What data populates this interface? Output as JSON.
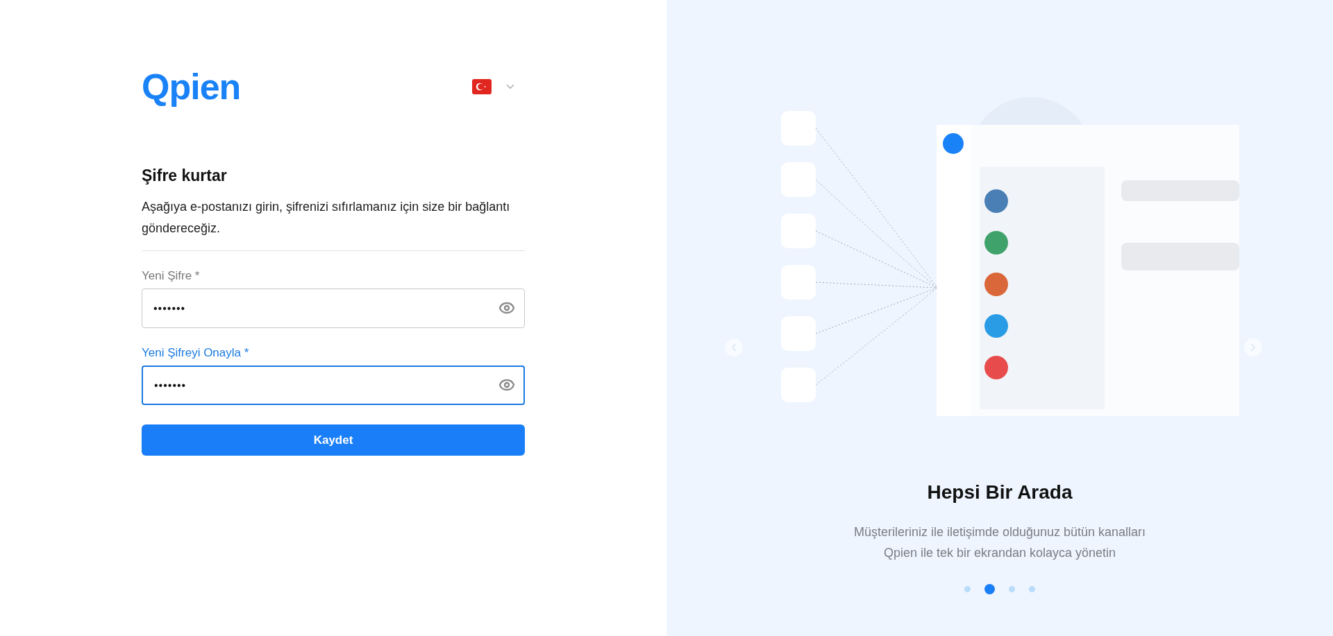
{
  "logo": {
    "text": "Qpien"
  },
  "form": {
    "title": "Şifre kurtar",
    "description": "Aşağıya e-postanızı girin, şifrenizi sıfırlamanız için size bir bağlantı göndereceğiz.",
    "fields": [
      {
        "label": "Yeni Şifre *",
        "value": "•••••••",
        "focused": false
      },
      {
        "label": "Yeni Şifreyi Onayla *",
        "value": "•••••••",
        "focused": true
      }
    ],
    "submit": "Kaydet"
  },
  "carousel": {
    "title": "Hepsi Bir Arada",
    "text_lines": [
      "Müşterileriniz ile iletişimde olduğunuz bütün kanalları",
      "Qpien ile tek bir ekrandan kolayca yönetin"
    ],
    "slides": [
      {
        "selected": false
      },
      {
        "selected": true
      },
      {
        "selected": false
      },
      {
        "selected": false
      }
    ]
  }
}
